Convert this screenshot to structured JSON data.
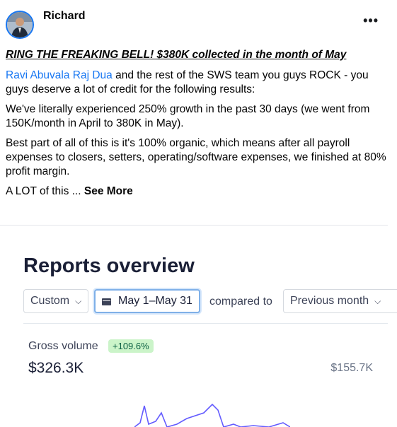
{
  "post": {
    "author": "Richard",
    "more_label": "•••",
    "title": "RING THE FREAKING BELL! $380K collected in the month of May",
    "para1_mention": "Ravi Abuvala Raj Dua",
    "para1_rest": " and the rest of the SWS team you guys ROCK - you guys deserve a lot of credit for the following results:",
    "para2": "We've literally experienced 250% growth in the past 30 days (we went from 150K/month in April to 380K in May).",
    "para3": "Best part of all of this is it's 100% organic, which means after all payroll expenses to closers, setters, operating/software expenses, we finished at 80% profit margin.",
    "para4_text": "A LOT of this ... ",
    "see_more": "See More"
  },
  "report": {
    "title": "Reports overview",
    "range_select": "Custom",
    "date_range": "May 1–May 31",
    "compared_to": "compared to",
    "compare_select": "Previous month",
    "metric_label": "Gross volume",
    "metric_change": "+109.6%",
    "metric_value": "$326.3K",
    "compare_value": "$155.7K",
    "accent_color": "#635bff"
  }
}
